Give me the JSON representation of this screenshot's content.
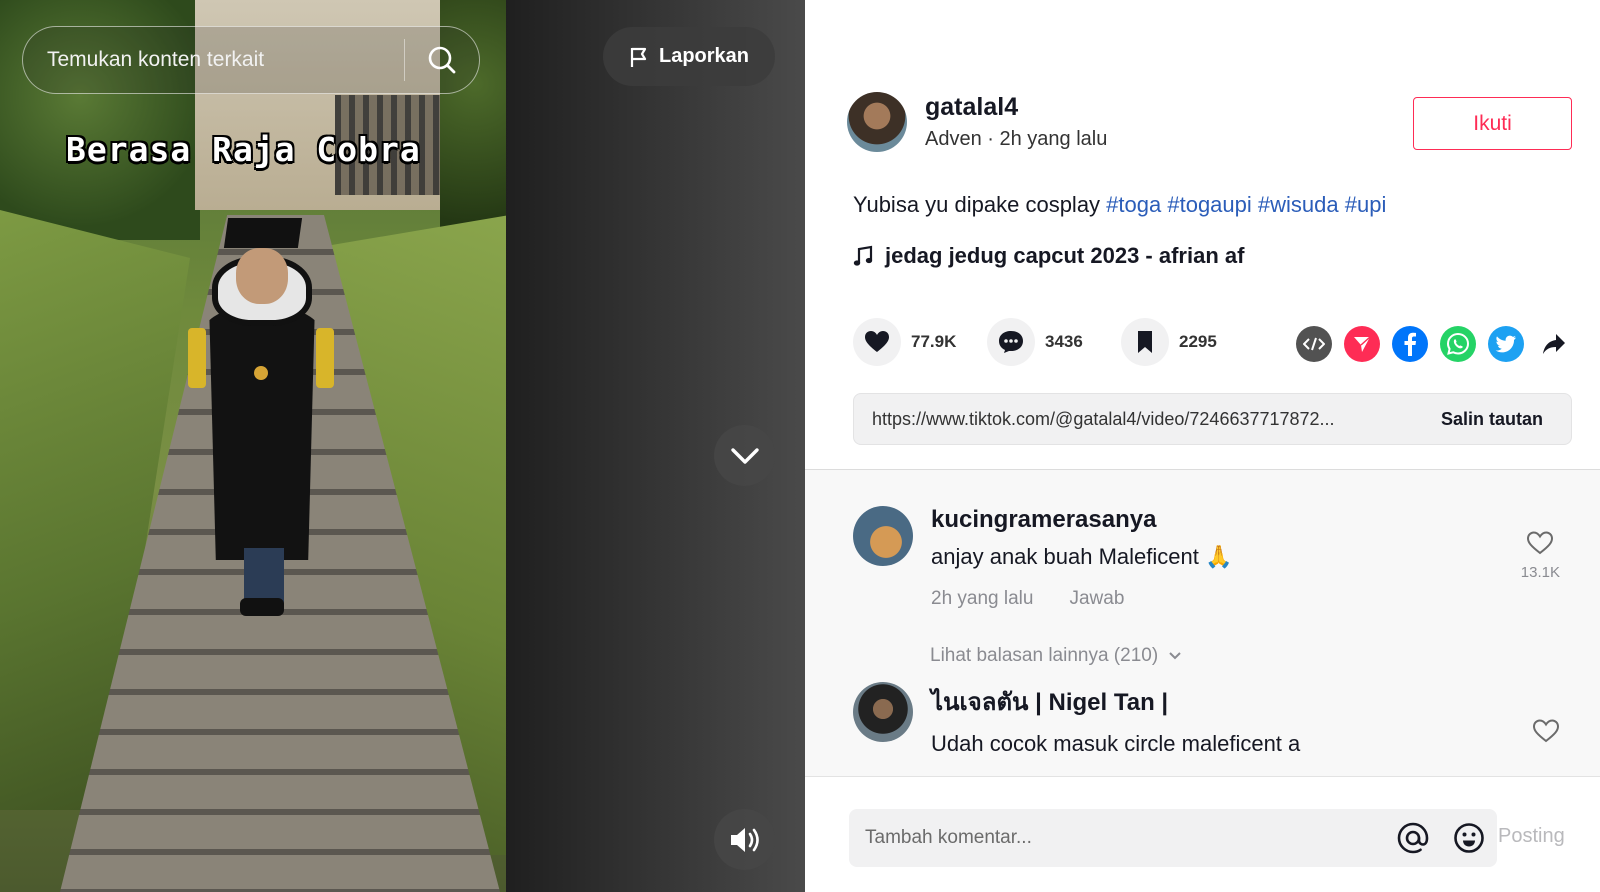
{
  "video": {
    "overlay_text": "Berasa Raja Cobra",
    "search_placeholder": "Temukan konten terkait",
    "report_label": "Laporkan"
  },
  "author": {
    "username": "gatalal4",
    "nickname": "Adven",
    "separator": " · ",
    "posted": "2h yang lalu",
    "follow_label": "Ikuti"
  },
  "description": {
    "text": "Yubisa yu dipake cosplay ",
    "tags": [
      "#toga",
      "#togaupi",
      "#wisuda",
      "#upi"
    ]
  },
  "music": {
    "title": "jedag jedug capcut 2023 - afrian af"
  },
  "stats": {
    "likes": "77.9K",
    "comments": "3436",
    "saves": "2295"
  },
  "share_icons": [
    "embed-icon",
    "send-icon",
    "facebook-icon",
    "whatsapp-icon",
    "twitter-icon",
    "share-arrow-icon"
  ],
  "link": {
    "url": "https://www.tiktok.com/@gatalal4/video/7246637717872...",
    "copy_label": "Salin tautan"
  },
  "comments": [
    {
      "user": "kucingramerasanya",
      "text": "anjay anak buah Maleficent 🙏",
      "time": "2h yang lalu",
      "reply_label": "Jawab",
      "likes": "13.1K",
      "more_replies": "Lihat balasan lainnya (210)"
    },
    {
      "user": "ไนเจลตัน | Nigel Tan |",
      "text": "Udah cocok masuk circle maleficent a"
    }
  ],
  "comment_bar": {
    "placeholder": "Tambah komentar...",
    "post_label": "Posting"
  },
  "colors": {
    "accent": "#fe2c55",
    "tag": "#2b5db9"
  }
}
